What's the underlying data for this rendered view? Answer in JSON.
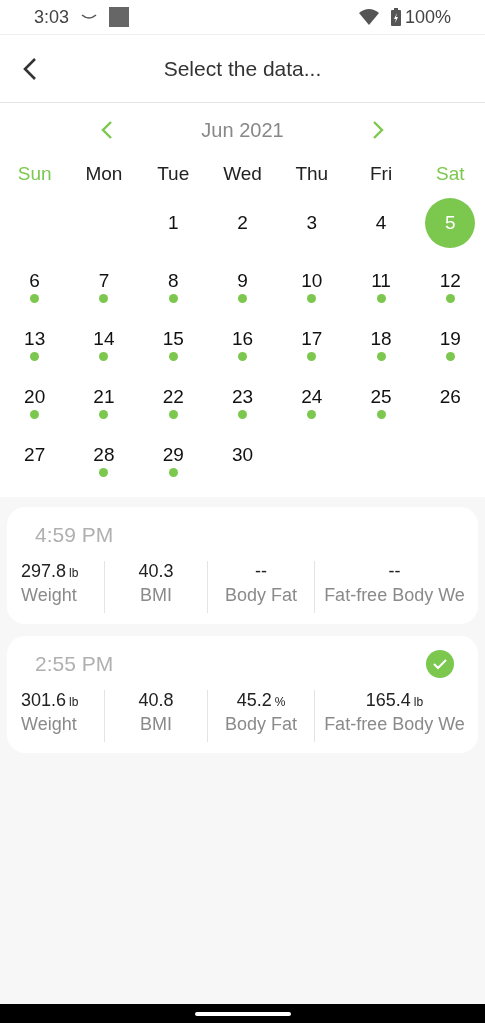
{
  "status_bar": {
    "time": "3:03",
    "battery": "100%"
  },
  "header": {
    "title": "Select the data..."
  },
  "calendar": {
    "month": "Jun 2021",
    "weekdays": [
      {
        "label": "Sun",
        "weekend": true
      },
      {
        "label": "Mon",
        "weekend": false
      },
      {
        "label": "Tue",
        "weekend": false
      },
      {
        "label": "Wed",
        "weekend": false
      },
      {
        "label": "Thu",
        "weekend": false
      },
      {
        "label": "Fri",
        "weekend": false
      },
      {
        "label": "Sat",
        "weekend": true
      }
    ],
    "cells": [
      {
        "kind": "blank"
      },
      {
        "kind": "blank"
      },
      {
        "kind": "day",
        "day": "1",
        "has_data": false,
        "selected": false
      },
      {
        "kind": "day",
        "day": "2",
        "has_data": false,
        "selected": false
      },
      {
        "kind": "day",
        "day": "3",
        "has_data": false,
        "selected": false
      },
      {
        "kind": "day",
        "day": "4",
        "has_data": false,
        "selected": false
      },
      {
        "kind": "day",
        "day": "5",
        "has_data": false,
        "selected": true
      },
      {
        "kind": "day",
        "day": "6",
        "has_data": true,
        "selected": false
      },
      {
        "kind": "day",
        "day": "7",
        "has_data": true,
        "selected": false
      },
      {
        "kind": "day",
        "day": "8",
        "has_data": true,
        "selected": false
      },
      {
        "kind": "day",
        "day": "9",
        "has_data": true,
        "selected": false
      },
      {
        "kind": "day",
        "day": "10",
        "has_data": true,
        "selected": false
      },
      {
        "kind": "day",
        "day": "11",
        "has_data": true,
        "selected": false
      },
      {
        "kind": "day",
        "day": "12",
        "has_data": true,
        "selected": false
      },
      {
        "kind": "day",
        "day": "13",
        "has_data": true,
        "selected": false
      },
      {
        "kind": "day",
        "day": "14",
        "has_data": true,
        "selected": false
      },
      {
        "kind": "day",
        "day": "15",
        "has_data": true,
        "selected": false
      },
      {
        "kind": "day",
        "day": "16",
        "has_data": true,
        "selected": false
      },
      {
        "kind": "day",
        "day": "17",
        "has_data": true,
        "selected": false
      },
      {
        "kind": "day",
        "day": "18",
        "has_data": true,
        "selected": false
      },
      {
        "kind": "day",
        "day": "19",
        "has_data": true,
        "selected": false
      },
      {
        "kind": "day",
        "day": "20",
        "has_data": true,
        "selected": false
      },
      {
        "kind": "day",
        "day": "21",
        "has_data": true,
        "selected": false
      },
      {
        "kind": "day",
        "day": "22",
        "has_data": true,
        "selected": false
      },
      {
        "kind": "day",
        "day": "23",
        "has_data": true,
        "selected": false
      },
      {
        "kind": "day",
        "day": "24",
        "has_data": true,
        "selected": false
      },
      {
        "kind": "day",
        "day": "25",
        "has_data": true,
        "selected": false
      },
      {
        "kind": "day",
        "day": "26",
        "has_data": false,
        "selected": false
      },
      {
        "kind": "day",
        "day": "27",
        "has_data": false,
        "selected": false
      },
      {
        "kind": "day",
        "day": "28",
        "has_data": true,
        "selected": false
      },
      {
        "kind": "day",
        "day": "29",
        "has_data": true,
        "selected": false
      },
      {
        "kind": "day",
        "day": "30",
        "has_data": false,
        "selected": false
      }
    ]
  },
  "records": [
    {
      "time": "4:59 PM",
      "selected": false,
      "metrics": [
        {
          "value": "297.8",
          "unit": "lb",
          "label": "Weight"
        },
        {
          "value": "40.3",
          "label": "BMI"
        },
        {
          "value": "--",
          "label": "Body Fat"
        },
        {
          "value": "--",
          "label": "Fat-free Body We"
        }
      ]
    },
    {
      "time": "2:55 PM",
      "selected": true,
      "metrics": [
        {
          "value": "301.6",
          "unit": "lb",
          "label": "Weight"
        },
        {
          "value": "40.8",
          "label": "BMI"
        },
        {
          "value": "45.2",
          "unit": "%",
          "label": "Body Fat"
        },
        {
          "value": "165.4",
          "unit": "lb",
          "label": "Fat-free Body We"
        }
      ]
    }
  ]
}
